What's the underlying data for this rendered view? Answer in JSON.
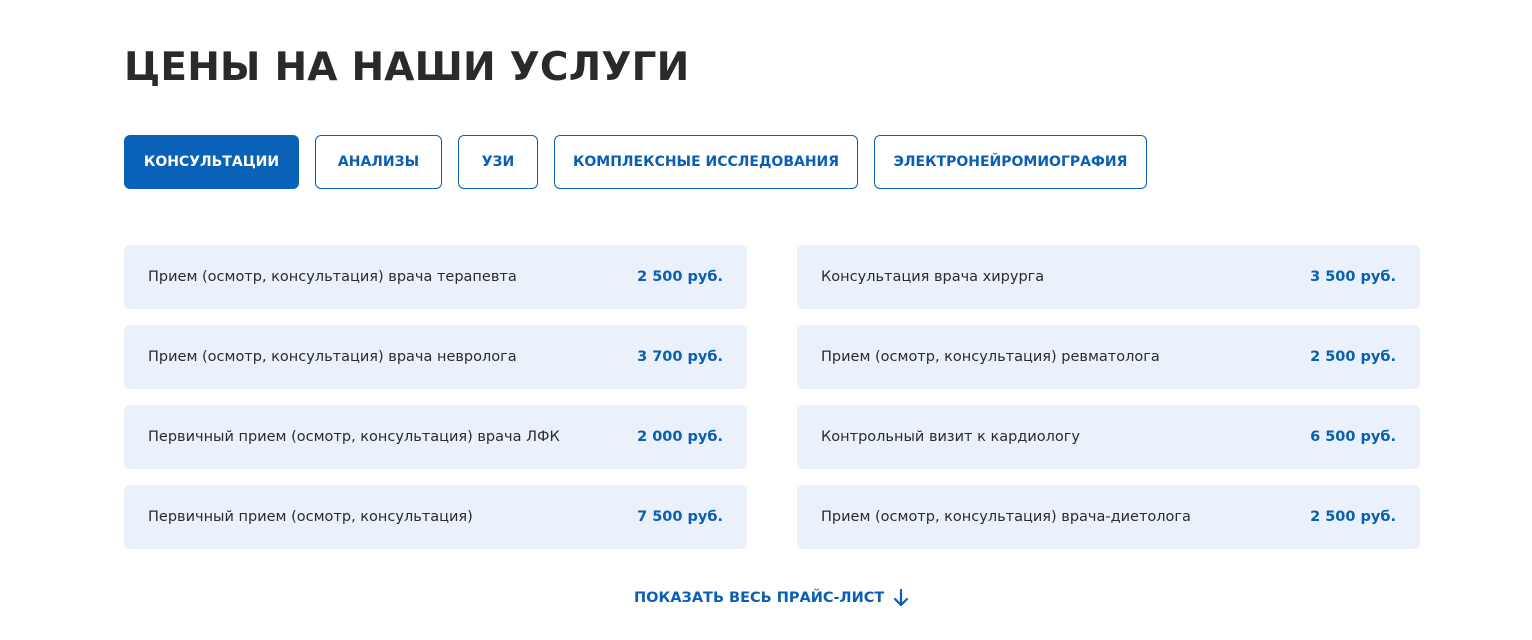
{
  "page": {
    "title": "ЦЕНЫ НА НАШИ УСЛУГИ"
  },
  "tabs": [
    {
      "label": "КОНСУЛЬТАЦИИ",
      "active": true
    },
    {
      "label": "АНАЛИЗЫ",
      "active": false
    },
    {
      "label": "УЗИ",
      "active": false
    },
    {
      "label": "КОМПЛЕКСНЫЕ ИССЛЕДОВАНИЯ",
      "active": false
    },
    {
      "label": "ЭЛЕКТРОНЕЙРОМИОГРАФИЯ",
      "active": false
    }
  ],
  "prices": [
    {
      "name": "Прием (осмотр, консультация) врача терапевта",
      "price": "2 500 руб."
    },
    {
      "name": "Консультация врача хирурга",
      "price": "3 500 руб."
    },
    {
      "name": "Прием (осмотр, консультация) врача невролога",
      "price": "3 700 руб."
    },
    {
      "name": "Прием (осмотр, консультация) ревматолога",
      "price": "2 500 руб."
    },
    {
      "name": "Первичный прием (осмотр, консультация) врача ЛФК",
      "price": "2 000 руб."
    },
    {
      "name": "Контрольный визит к кардиологу",
      "price": "6 500 руб."
    },
    {
      "name": "Первичный прием (осмотр, консультация)",
      "price": "7 500 руб."
    },
    {
      "name": "Прием (осмотр, консультация) врача-диетолога",
      "price": "2 500 руб."
    }
  ],
  "footer": {
    "show_all_label": "ПОКАЗАТЬ ВЕСЬ ПРАЙС-ЛИСТ",
    "show_all_icon": "arrow-down-icon"
  },
  "colors": {
    "accent": "#0a62b8",
    "row_background": "#eaf1fa",
    "title_text": "#2a2a2a"
  }
}
